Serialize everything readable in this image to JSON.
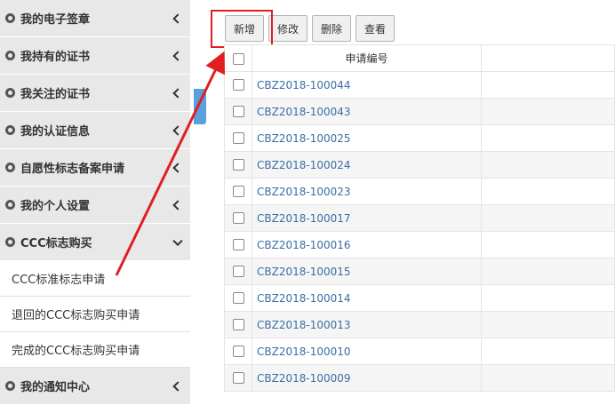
{
  "sidebar": {
    "items": [
      {
        "label": "我的电子签章"
      },
      {
        "label": "我持有的证书"
      },
      {
        "label": "我关注的证书"
      },
      {
        "label": "我的认证信息"
      },
      {
        "label": "自愿性标志备案申请"
      },
      {
        "label": "我的个人设置"
      },
      {
        "label": "CCC标志购买"
      },
      {
        "label": "我的通知中心"
      }
    ],
    "subitems": [
      {
        "label": "CCC标准标志申请"
      },
      {
        "label": "退回的CCC标志购买申请"
      },
      {
        "label": "完成的CCC标志购买申请"
      }
    ]
  },
  "toolbar": {
    "add_label": "新增",
    "edit_label": "修改",
    "delete_label": "删除",
    "view_label": "查看"
  },
  "table": {
    "header": "申请编号",
    "rows": [
      "CBZ2018-100044",
      "CBZ2018-100043",
      "CBZ2018-100025",
      "CBZ2018-100024",
      "CBZ2018-100023",
      "CBZ2018-100017",
      "CBZ2018-100016",
      "CBZ2018-100015",
      "CBZ2018-100014",
      "CBZ2018-100013",
      "CBZ2018-100010",
      "CBZ2018-100009"
    ]
  },
  "colors": {
    "sidebar_bg": "#e8e8e8",
    "link": "#3a6ea5",
    "annotation": "#e02020",
    "collapse_tab": "#5aa0dc"
  }
}
